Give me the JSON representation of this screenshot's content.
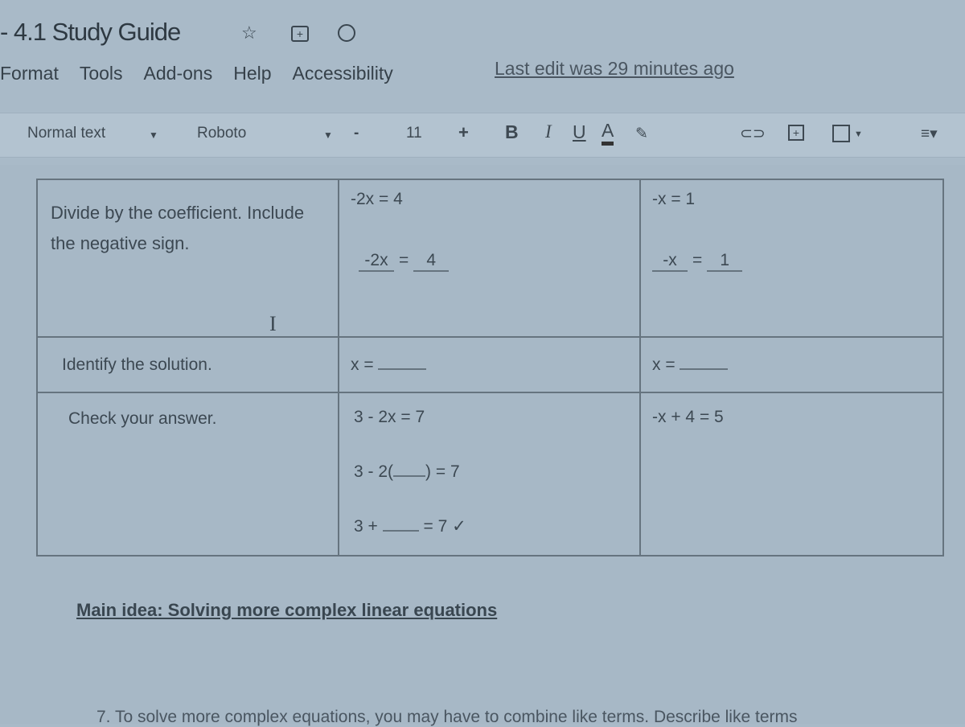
{
  "header": {
    "title": "- 4.1 Study Guide",
    "icons": [
      "star-icon",
      "move-to-folder-icon",
      "cloud-saved-icon"
    ]
  },
  "menu": [
    "Format",
    "Tools",
    "Add-ons",
    "Help",
    "Accessibility"
  ],
  "last_edit": "Last edit was 29 minutes ago",
  "toolbar": {
    "style": "Normal text",
    "font": "Roboto",
    "size_minus": "-",
    "font_size": "11",
    "size_plus": "+",
    "bold": "B",
    "italic": "I",
    "underline": "U",
    "text_color": "A",
    "text_color_hex": "#333333"
  },
  "table": {
    "rows": [
      {
        "label": "Divide by the coefficient. Include the negative sign.",
        "col1": {
          "eq": "-2x = 4",
          "num_left": "-2x",
          "eq_sign": "=",
          "num_right": "4"
        },
        "col2": {
          "eq": "-x = 1",
          "num_left": "-x",
          "eq_sign": "=",
          "num_right": "1"
        }
      },
      {
        "label": "Identify the solution.",
        "col1": "x =",
        "col2": "x ="
      },
      {
        "label": "Check your answer.",
        "col1": [
          "3 - 2x = 7",
          "3 - 2(",
          ") = 7",
          "3 +",
          "= 7 ✓"
        ],
        "col2": "-x + 4 = 5"
      }
    ]
  },
  "main_idea": "Main idea: Solving more complex linear equations",
  "question7": "7. To solve more complex equations, you may have to combine like terms. Describe like terms"
}
